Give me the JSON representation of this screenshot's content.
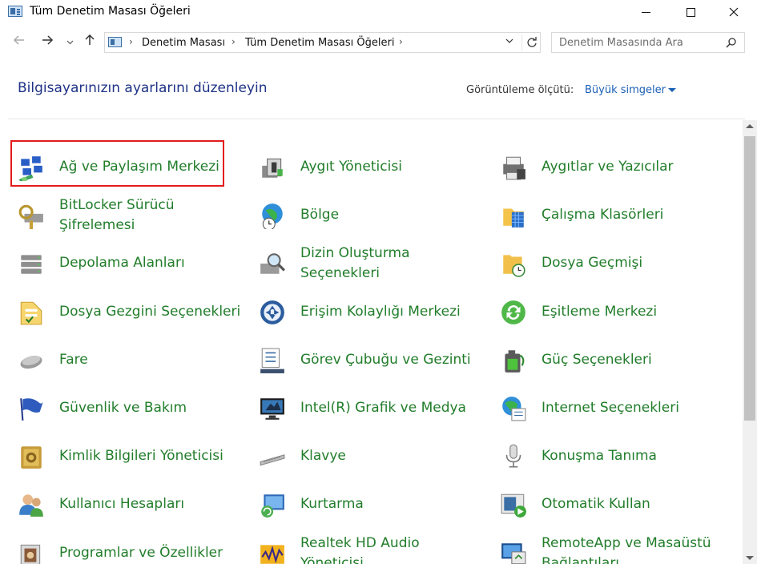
{
  "window": {
    "title": "Tüm Denetim Masası Öğeleri"
  },
  "address": {
    "crumbs": [
      "Denetim Masası",
      "Tüm Denetim Masası Öğeleri"
    ],
    "search_placeholder": "Denetim Masasında Ara"
  },
  "header": {
    "heading": "Bilgisayarınızın ayarlarını düzenleyin",
    "view_label": "Görüntüleme ölçütü:",
    "view_value": "Büyük simgeler"
  },
  "items": [
    {
      "label1": "Ağ ve Paylaşım Merkezi",
      "label2": "",
      "icon": "network-icon",
      "highlighted": true
    },
    {
      "label1": "Aygıt Yöneticisi",
      "label2": "",
      "icon": "device-manager-icon"
    },
    {
      "label1": "Aygıtlar ve Yazıcılar",
      "label2": "",
      "icon": "printer-icon"
    },
    {
      "label1": "BitLocker Sürücü",
      "label2": "Şifrelemesi",
      "icon": "bitlocker-icon"
    },
    {
      "label1": "Bölge",
      "label2": "",
      "icon": "globe-clock-icon"
    },
    {
      "label1": "Çalışma Klasörleri",
      "label2": "",
      "icon": "work-folders-icon"
    },
    {
      "label1": "Depolama Alanları",
      "label2": "",
      "icon": "storage-icon"
    },
    {
      "label1": "Dizin Oluşturma",
      "label2": "Seçenekleri",
      "icon": "indexing-icon"
    },
    {
      "label1": "Dosya Geçmişi",
      "label2": "",
      "icon": "file-history-icon"
    },
    {
      "label1": "Dosya Gezgini Seçenekleri",
      "label2": "",
      "icon": "folder-options-icon"
    },
    {
      "label1": "Erişim Kolaylığı Merkezi",
      "label2": "",
      "icon": "accessibility-icon"
    },
    {
      "label1": "Eşitleme Merkezi",
      "label2": "",
      "icon": "sync-icon"
    },
    {
      "label1": "Fare",
      "label2": "",
      "icon": "mouse-icon"
    },
    {
      "label1": "Görev Çubuğu ve Gezinti",
      "label2": "",
      "icon": "taskbar-icon"
    },
    {
      "label1": "Güç Seçenekleri",
      "label2": "",
      "icon": "battery-icon"
    },
    {
      "label1": "Güvenlik ve Bakım",
      "label2": "",
      "icon": "flag-icon"
    },
    {
      "label1": "Intel(R) Grafik ve Medya",
      "label2": "",
      "icon": "monitor-icon"
    },
    {
      "label1": "Internet Seçenekleri",
      "label2": "",
      "icon": "internet-options-icon"
    },
    {
      "label1": "Kimlik Bilgileri Yöneticisi",
      "label2": "",
      "icon": "credential-vault-icon"
    },
    {
      "label1": "Klavye",
      "label2": "",
      "icon": "keyboard-icon"
    },
    {
      "label1": "Konuşma Tanıma",
      "label2": "",
      "icon": "microphone-icon"
    },
    {
      "label1": "Kullanıcı Hesapları",
      "label2": "",
      "icon": "users-icon"
    },
    {
      "label1": "Kurtarma",
      "label2": "",
      "icon": "recovery-icon"
    },
    {
      "label1": "Otomatik Kullan",
      "label2": "",
      "icon": "autoplay-icon"
    },
    {
      "label1": "Programlar ve Özellikler",
      "label2": "",
      "icon": "programs-icon"
    },
    {
      "label1": "Realtek HD Audio",
      "label2": "Yöneticisi",
      "icon": "audio-manager-icon"
    },
    {
      "label1": "RemoteApp ve Masaüstü",
      "label2": "Bağlantıları",
      "icon": "remoteapp-icon"
    }
  ]
}
